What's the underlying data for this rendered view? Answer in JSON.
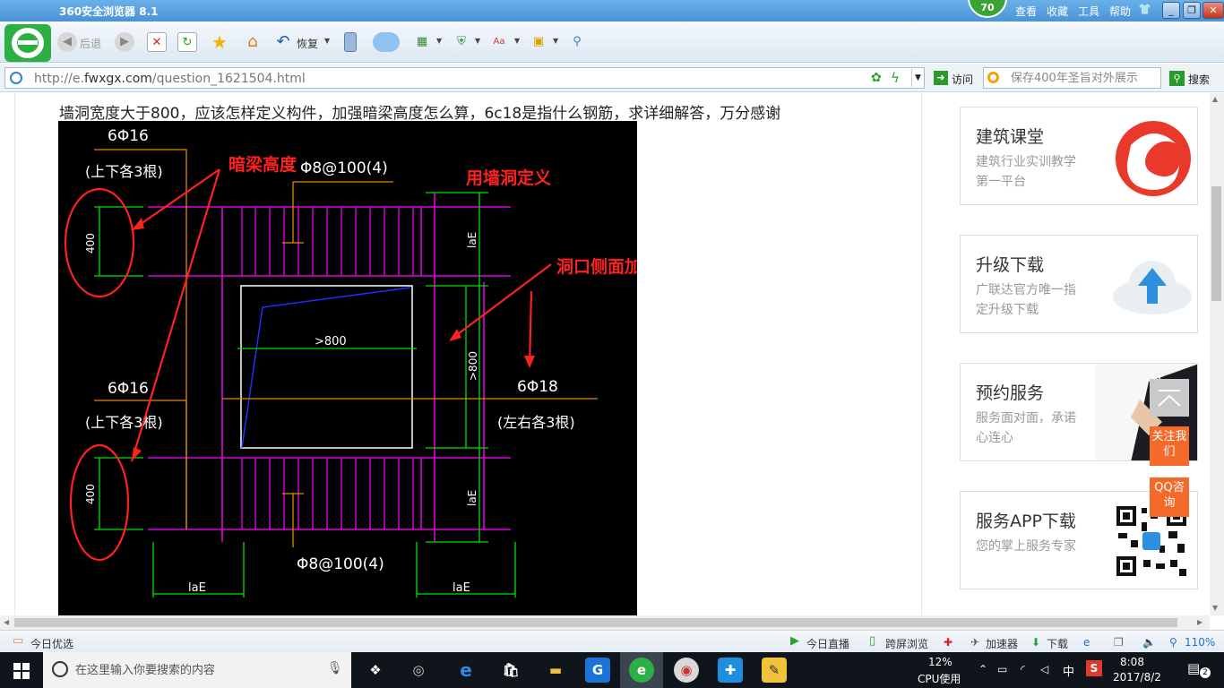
{
  "window": {
    "title": "360安全浏览器 8.1",
    "score": "70",
    "menu": [
      "查看",
      "收藏",
      "工具",
      "帮助"
    ]
  },
  "toolbar": {
    "back_label": "后退",
    "restore_label": "恢复"
  },
  "address": {
    "url_prefix": "http://e.",
    "url_domain": "fwxgx.com",
    "url_path": "/question_1621504.html",
    "visit_label": "访问",
    "search_placeholder": "保存400年圣旨对外展示",
    "search_label": "搜索"
  },
  "question": {
    "text": "墙洞宽度大于800，应该怎样定义构件，加强暗梁高度怎么算，6c18是指什么钢筋，求详细解答，万分感谢"
  },
  "drawing": {
    "annotations": {
      "beam_height": "暗梁高度",
      "define_as_wall_opening": "用墙洞定义",
      "side_reinforcement": "洞口侧面加强筋"
    },
    "labels": {
      "top_bars": "6Φ16",
      "top_bars_note": "(上下各3根)",
      "bottom_bars": "6Φ16",
      "bottom_bars_note": "(上下各3根)",
      "stirrup_top": "Φ8@100(4)",
      "stirrup_bottom": "Φ8@100(4)",
      "side_bars": "6Φ18",
      "side_bars_note": "(左右各3根)",
      "width": ">800",
      "height": ">800",
      "dim_400_top": "400",
      "dim_400_bottom": "400",
      "lae_right_top": "laE",
      "lae_right_bottom": "laE",
      "lae_bottom_left": "laE",
      "lae_bottom_right": "laE"
    }
  },
  "sidebar": {
    "cards": [
      {
        "title": "建筑课堂",
        "desc": "建筑行业实训教学第一平台",
        "icon": "course-logo-icon"
      },
      {
        "title": "升级下载",
        "desc": "广联达官方唯一指定升级下载",
        "icon": "cloud-upload-icon"
      },
      {
        "title": "预约服务",
        "desc": "服务面对面，承诺心连心",
        "icon": "handshake-icon"
      },
      {
        "title": "服务APP下载",
        "desc": "您的掌上服务专家",
        "icon": "qr-code-icon"
      }
    ],
    "follow_label": "关注我们",
    "qq_label": "QQ咨询"
  },
  "statusbar": {
    "today_picks": "今日优选",
    "live": "今日直播",
    "cross_screen": "跨屏浏览",
    "accelerator": "加速器",
    "download": "下载",
    "zoom": "110%"
  },
  "taskbar": {
    "search_placeholder": "在这里输入你要搜索的内容",
    "cpu_percent": "12%",
    "cpu_label": "CPU使用",
    "ime": "中",
    "time": "8:08",
    "date": "2017/8/2",
    "notifications": "2"
  },
  "colors": {
    "accent_green": "#2cb043",
    "title_blue": "#4a93d6",
    "float_orange": "#f5692b",
    "cad_magenta": "#e000e0",
    "cad_green": "#00e000",
    "cad_orange": "#e08a00",
    "annotation_red": "#ff2020"
  }
}
